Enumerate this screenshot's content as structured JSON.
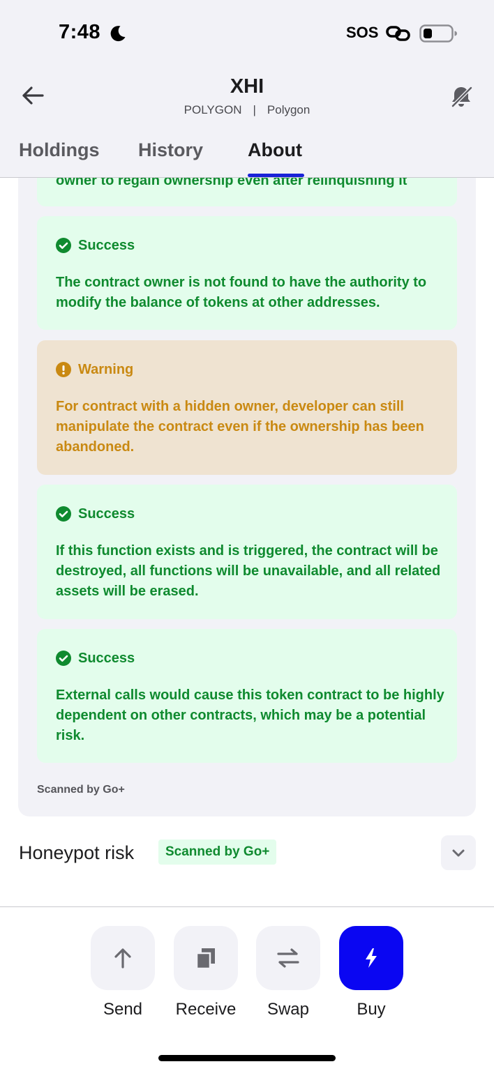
{
  "status_bar": {
    "time": "7:48",
    "sos": "SOS"
  },
  "header": {
    "title": "XHI",
    "network": "POLYGON",
    "separator": "|",
    "chain": "Polygon"
  },
  "tabs": [
    {
      "label": "Holdings",
      "active": false
    },
    {
      "label": "History",
      "active": false
    },
    {
      "label": "About",
      "active": true
    }
  ],
  "security_checks": {
    "partial_text": "owner to regain ownership even after relinquishing it",
    "items": [
      {
        "status": "Success",
        "type": "success",
        "text": "The contract owner is not found to have the authority to modify the balance of tokens at other addresses."
      },
      {
        "status": "Warning",
        "type": "warning",
        "text": "For contract with a hidden owner, developer can still manipulate the contract even if the ownership has been abandoned."
      },
      {
        "status": "Success",
        "type": "success",
        "text": "If this function exists and is triggered, the contract will be destroyed, all functions will be unavailable, and all related assets will be erased."
      },
      {
        "status": "Success",
        "type": "success",
        "text": "External calls would cause this token contract to be highly dependent on other contracts, which may be a potential risk."
      }
    ],
    "scanned_by": "Scanned by Go+"
  },
  "honeypot": {
    "title": "Honeypot risk",
    "badge": "Scanned by Go+"
  },
  "actions": [
    {
      "label": "Send",
      "icon": "arrow-up-icon"
    },
    {
      "label": "Receive",
      "icon": "copy-icon"
    },
    {
      "label": "Swap",
      "icon": "swap-icon"
    },
    {
      "label": "Buy",
      "icon": "lightning-icon"
    }
  ],
  "colors": {
    "success_text": "#0f8a2f",
    "success_bg": "#e3fdec",
    "warning_text": "#c98912",
    "warning_bg": "#efe3d1",
    "accent": "#0a06f2"
  }
}
